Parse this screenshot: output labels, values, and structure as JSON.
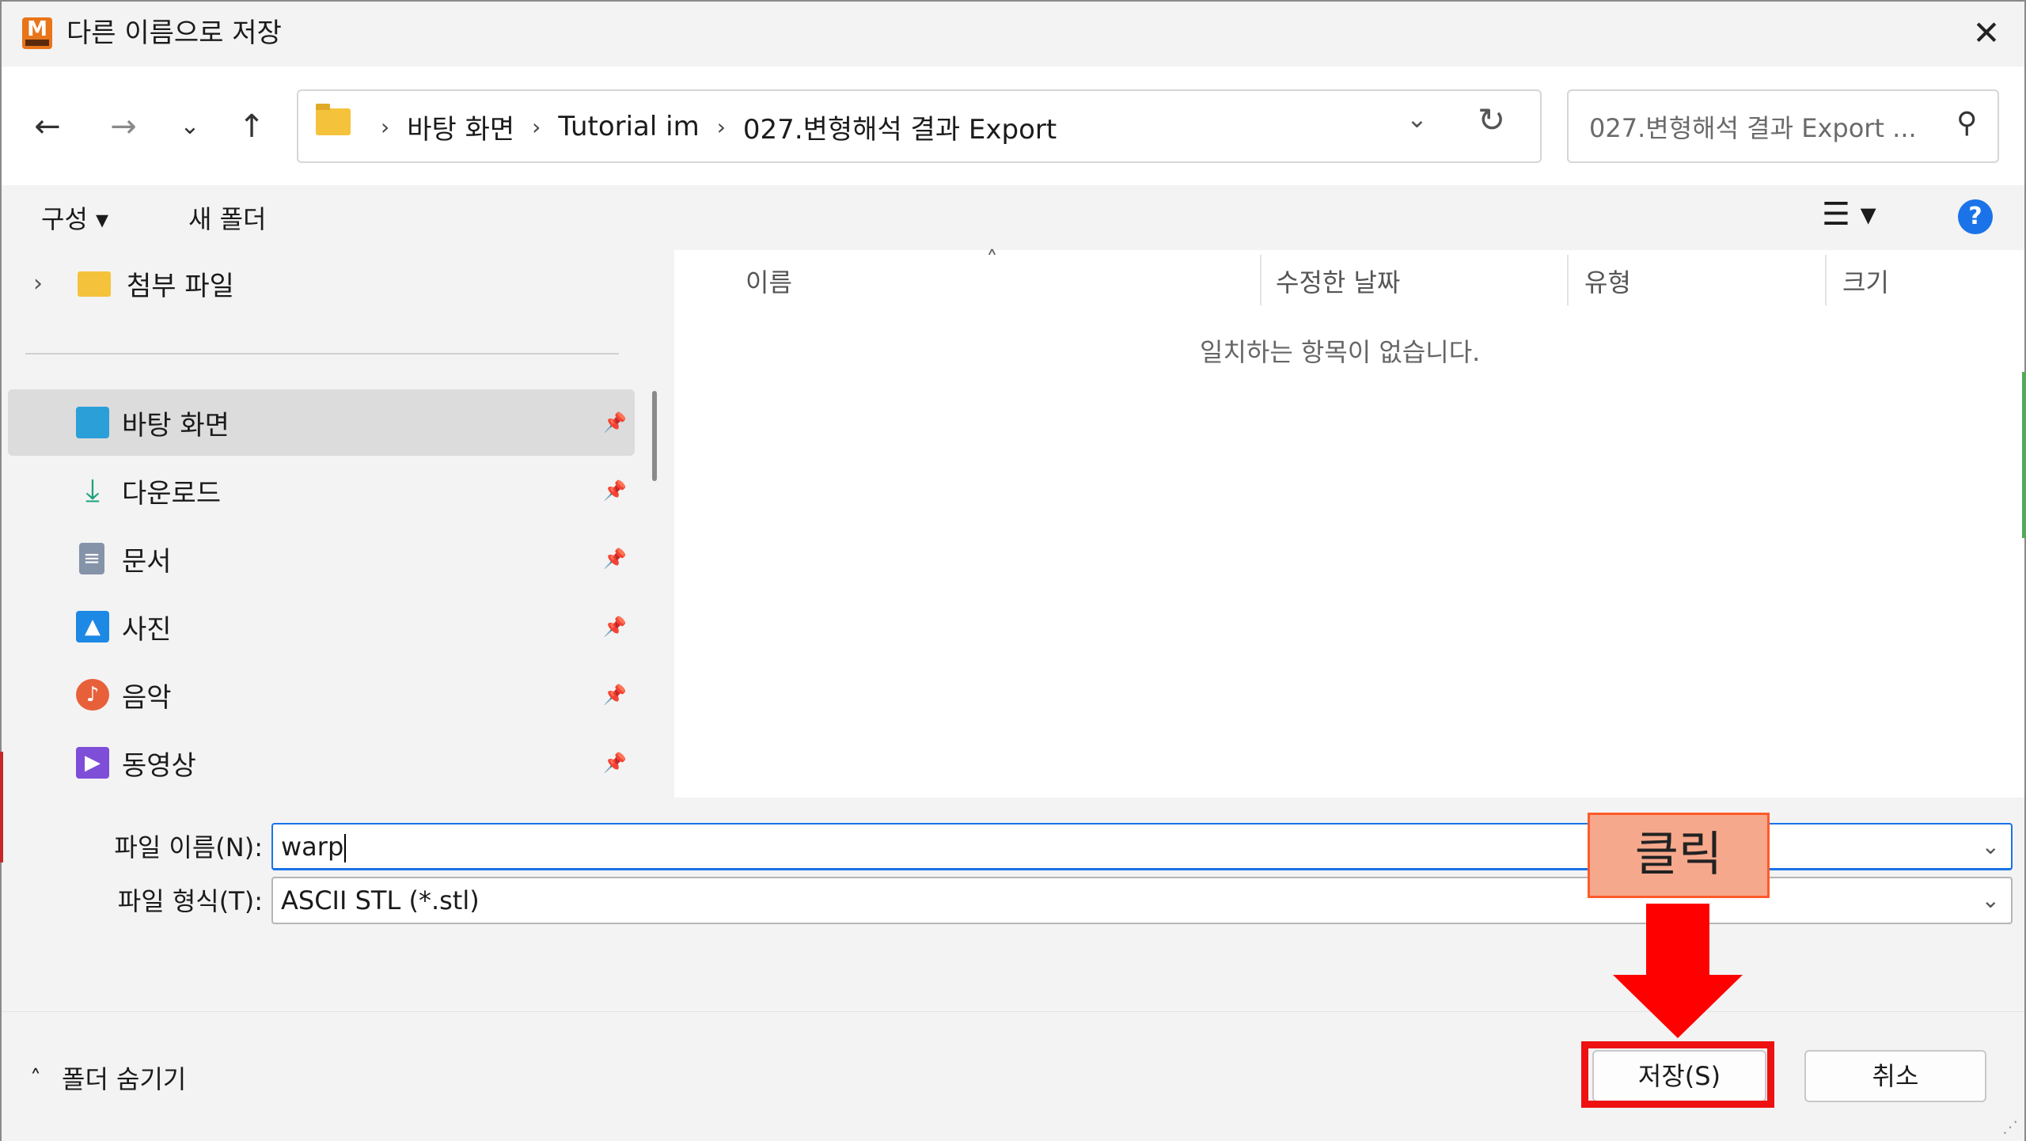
{
  "window": {
    "title": "다른 이름으로 저장",
    "app_icon_letter": "M",
    "close_glyph": "✕"
  },
  "nav": {
    "back": "←",
    "forward": "→",
    "recent": "⌄",
    "up": "↑",
    "breadcrumbs": [
      "바탕 화면",
      "Tutorial im",
      "027.변형해석 결과 Export"
    ],
    "separator": "›",
    "address_dropdown": "⌄",
    "refresh": "↻",
    "search_placeholder": "027.변형해석 결과 Export ...",
    "search_glyph": "⚲"
  },
  "command_bar": {
    "organize": "구성 ▾",
    "new_folder": "새 폴더",
    "view_glyph": "☰ ▾",
    "help": "?"
  },
  "nav_pane": {
    "tree_chevron": "›",
    "tree_item": "첨부 파일",
    "quick_access": [
      {
        "label": "바탕 화면",
        "icon": "desktop-icon",
        "color": "#2a9fd8",
        "selected": true
      },
      {
        "label": "다운로드",
        "icon": "download-icon",
        "color": "#1aa37a",
        "selected": false
      },
      {
        "label": "문서",
        "icon": "document-icon",
        "color": "#7a8aa0",
        "selected": false
      },
      {
        "label": "사진",
        "icon": "picture-icon",
        "color": "#1e88e5",
        "selected": false
      },
      {
        "label": "음악",
        "icon": "music-icon",
        "color": "#e8603a",
        "selected": false
      },
      {
        "label": "동영상",
        "icon": "video-icon",
        "color": "#7e4ed8",
        "selected": false
      }
    ],
    "pin_glyph": "📌"
  },
  "file_list": {
    "sort_indicator": "˄",
    "columns": [
      "이름",
      "수정한 날짜",
      "유형",
      "크기"
    ],
    "empty_message": "일치하는 항목이 없습니다."
  },
  "fields": {
    "filename_label": "파일 이름(N):",
    "filename_value": "warp",
    "filetype_label": "파일 형식(T):",
    "filetype_value": "ASCII STL (*.stl)",
    "dropdown_glyph": "⌄"
  },
  "bottom": {
    "hide_folders": "폴더 숨기기",
    "hide_chevron": "˄",
    "save": "저장(S)",
    "cancel": "취소"
  },
  "annotation": {
    "label": "클릭",
    "color": "#ff0000"
  }
}
